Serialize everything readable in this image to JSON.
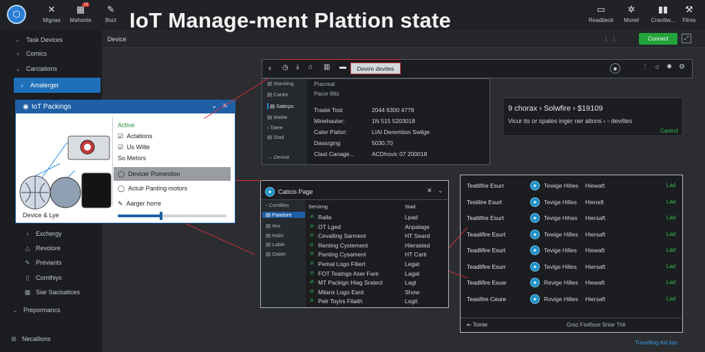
{
  "overlay_title": "IoT Manage-ment Plattion state",
  "topbar": {
    "left_buttons": [
      {
        "label": "Mignas",
        "icon": "x-mark-icon"
      },
      {
        "label": "Mahonte",
        "icon": "grid-icon",
        "badge": "10"
      },
      {
        "label": "Boct",
        "icon": "edit-icon"
      }
    ],
    "right_buttons": [
      {
        "label": "Readbeck",
        "icon": "tablet-icon"
      },
      {
        "label": "Monel",
        "icon": "settings-icon"
      },
      {
        "label": "Cravitiw...",
        "icon": "bar-chart-icon"
      },
      {
        "label": "Flires",
        "icon": "wrench-icon"
      }
    ]
  },
  "sidebar": {
    "items": [
      {
        "label": "Task Devices",
        "icon": "arrow-left-icon"
      },
      {
        "label": "Comics",
        "icon": "chevron-icon"
      },
      {
        "label": "Carciations",
        "icon": "chevron-icon"
      },
      {
        "label": "Amalerger",
        "icon": "chevron-icon",
        "active": true
      },
      {
        "label": "Exchergy",
        "icon": "chevron-icon"
      },
      {
        "label": "Revolore",
        "icon": "triangle-icon"
      },
      {
        "label": "Previants",
        "icon": "pencil-icon"
      },
      {
        "label": "Comthiys",
        "icon": "document-icon"
      },
      {
        "label": "Siar Sacisatices",
        "icon": "grid-icon"
      },
      {
        "label": "Prepormancs",
        "icon": "chevron-down-icon"
      },
      {
        "label": "Necallions",
        "icon": "plus-box-icon"
      }
    ]
  },
  "header": {
    "device_label": "Device",
    "connect_label": "Connect",
    "dots": "⋮ ⋮"
  },
  "device_panel": {
    "tab_label": "Devire devites",
    "menu": [
      "Stantiing",
      "Cantie",
      "Salerps",
      "Matite",
      "Tatee",
      "Stad"
    ],
    "menu_bottom": "Devise",
    "section_a": "Pracreat",
    "section_b": "Pacor lilits",
    "rows": [
      {
        "label": "Traste Tost",
        "value": "2044 6300 4778"
      },
      {
        "label": "Minehauter:",
        "value": "1N 515 5203018"
      },
      {
        "label": "Cater Pattor:",
        "value": "LIAI Deremtion Swilge"
      },
      {
        "label": "Dassrging",
        "value": "5030.70"
      },
      {
        "label": "Clast Canage...",
        "value": "ACDhovic 07 200018"
      }
    ]
  },
  "summary_panel": {
    "line1": "9 chorax › Solwfire › $19109",
    "line2": "Vicur its or spates inger ner altons › ◦ deviltes",
    "link": "Cantrol"
  },
  "dialog": {
    "title": "IoT Packings",
    "close": "✕",
    "image_caption": "Device & Lye",
    "options": [
      {
        "label": "Active",
        "check": false,
        "style": "green"
      },
      {
        "label": "Actations",
        "check": true
      },
      {
        "label": "Us Wilte",
        "check": true
      },
      {
        "label": "So Metors",
        "check": false
      },
      {
        "label": "Devicer Pomestion",
        "check": false,
        "selected": true
      },
      {
        "label": "Actulr Panting motors",
        "check": false
      },
      {
        "label": "Aarger horre",
        "check": false
      }
    ],
    "slider_value": 0.4
  },
  "list_panel": {
    "title": "Caticis Page",
    "nav": [
      "Contlifes",
      "Paadore",
      "Ites",
      "Halis",
      "Lable",
      "Oatier"
    ],
    "col_a": "Servirng",
    "col_b": "Stad",
    "rows": [
      {
        "a": "Raila",
        "b": "Lpad"
      },
      {
        "a": "OT Lged",
        "b": "Anpalage"
      },
      {
        "a": "Cevailing Sarment",
        "b": "HT Seard"
      },
      {
        "a": "Renting Cystement",
        "b": "Hierasted"
      },
      {
        "a": "Panting Cysament",
        "b": "HT Carti"
      },
      {
        "a": "Pemal Logo Filiert",
        "b": "Legat"
      },
      {
        "a": "FOT Teatngs Aser Fare",
        "b": "Lagat"
      },
      {
        "a": "MT Packign Hiag Sratect",
        "b": "Lagt"
      },
      {
        "a": "Milans Logo Eard",
        "b": "Show"
      },
      {
        "a": "Pelr Toyirs Filaith",
        "b": "Logit"
      }
    ]
  },
  "right_panel": {
    "rows": [
      {
        "a": "Teatlifire Esurr",
        "b": "Tewige Hities",
        "c": "Hiewaft",
        "d": "Lad"
      },
      {
        "a": "Testilire Esurt",
        "b": "Tevige Hilles",
        "c": "Hienaft",
        "d": "Lad"
      },
      {
        "a": "Teatlifire Esurt",
        "b": "Tevige Hihes",
        "c": "Hiersaft",
        "d": "Lad"
      },
      {
        "a": "Teaalifire Esurt",
        "b": "Tewige Hilles",
        "c": "Hiersaft",
        "d": "Lad"
      },
      {
        "a": "Teadlifire Esurt",
        "b": "Tevige Hilles",
        "c": "Hiewaft",
        "d": "Lad"
      },
      {
        "a": "Teadlifire Esurr",
        "b": "Tevlge Hilles",
        "c": "Hiersaft",
        "d": "Lad"
      },
      {
        "a": "Teadlifire Esuw",
        "b": "Revige Hilles",
        "c": "Hiewaft",
        "d": "Lad"
      },
      {
        "a": "Teasifire Ceure",
        "b": "Rovige Hilles",
        "c": "Hiersaft",
        "d": "Lad"
      }
    ],
    "footer_left": "Tomie",
    "footer_right": "Graz Fsefisse    Snlar Thit"
  },
  "corner_link": "Travelling Aid lias"
}
